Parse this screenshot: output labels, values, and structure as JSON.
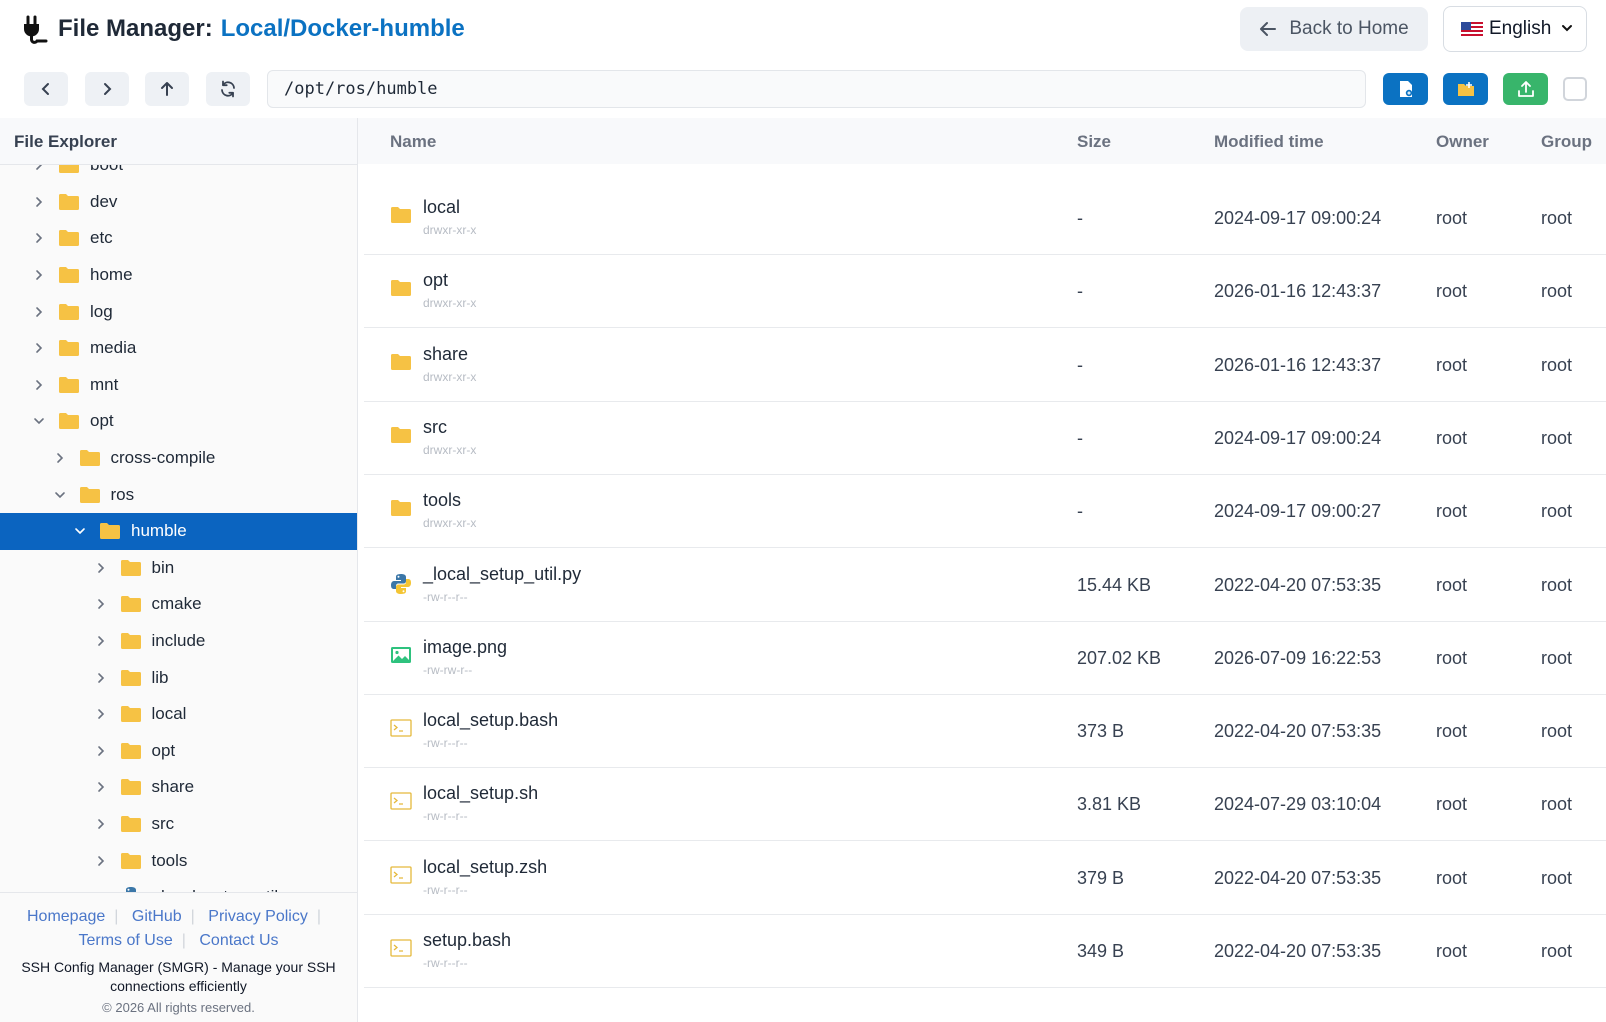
{
  "header": {
    "title": "File Manager:",
    "connection": "Local/Docker-humble",
    "back_label": "Back to Home",
    "language": "English",
    "plug_icon": "plug-icon",
    "flag_icon": "us-flag-icon"
  },
  "toolbar": {
    "path": "/opt/ros/humble",
    "buttons": [
      "back-icon",
      "forward-icon",
      "up-arrow-icon",
      "refresh-icon",
      "new-file-icon",
      "new-folder-icon",
      "upload-icon"
    ]
  },
  "sidebar": {
    "title": "File Explorer",
    "tree": [
      {
        "label": "boot",
        "depth": 0,
        "expanded": false,
        "selected": false
      },
      {
        "label": "dev",
        "depth": 0,
        "expanded": false,
        "selected": false
      },
      {
        "label": "etc",
        "depth": 0,
        "expanded": false,
        "selected": false
      },
      {
        "label": "home",
        "depth": 0,
        "expanded": false,
        "selected": false
      },
      {
        "label": "log",
        "depth": 0,
        "expanded": false,
        "selected": false
      },
      {
        "label": "media",
        "depth": 0,
        "expanded": false,
        "selected": false
      },
      {
        "label": "mnt",
        "depth": 0,
        "expanded": false,
        "selected": false
      },
      {
        "label": "opt",
        "depth": 0,
        "expanded": true,
        "selected": false
      },
      {
        "label": "cross-compile",
        "depth": 1,
        "expanded": false,
        "selected": false
      },
      {
        "label": "ros",
        "depth": 1,
        "expanded": true,
        "selected": false
      },
      {
        "label": "humble",
        "depth": 2,
        "expanded": true,
        "selected": true
      },
      {
        "label": "bin",
        "depth": 3,
        "expanded": false,
        "selected": false
      },
      {
        "label": "cmake",
        "depth": 3,
        "expanded": false,
        "selected": false
      },
      {
        "label": "include",
        "depth": 3,
        "expanded": false,
        "selected": false
      },
      {
        "label": "lib",
        "depth": 3,
        "expanded": false,
        "selected": false
      },
      {
        "label": "local",
        "depth": 3,
        "expanded": false,
        "selected": false
      },
      {
        "label": "opt",
        "depth": 3,
        "expanded": false,
        "selected": false
      },
      {
        "label": "share",
        "depth": 3,
        "expanded": false,
        "selected": false
      },
      {
        "label": "src",
        "depth": 3,
        "expanded": false,
        "selected": false
      },
      {
        "label": "tools",
        "depth": 3,
        "expanded": false,
        "selected": false
      },
      {
        "label": "_local_setup_util.py",
        "depth": 3,
        "file": true,
        "icon": "python-icon",
        "selected": false
      }
    ],
    "footer": {
      "links": [
        "Homepage",
        "GitHub",
        "Privacy Policy",
        "Terms of Use",
        "Contact Us"
      ],
      "description": "SSH Config Manager (SMGR) - Manage your SSH connections efficiently",
      "copyright": "© 2026 All rights reserved."
    }
  },
  "table": {
    "columns": [
      "Name",
      "Size",
      "Modified time",
      "Owner",
      "Group"
    ],
    "rows": [
      {
        "name": "local",
        "perm": "drwxr-xr-x",
        "size": "-",
        "modified": "2024-09-17 09:00:24",
        "owner": "root",
        "group": "root",
        "icon": "folder-icon"
      },
      {
        "name": "opt",
        "perm": "drwxr-xr-x",
        "size": "-",
        "modified": "2026-01-16 12:43:37",
        "owner": "root",
        "group": "root",
        "icon": "folder-icon"
      },
      {
        "name": "share",
        "perm": "drwxr-xr-x",
        "size": "-",
        "modified": "2026-01-16 12:43:37",
        "owner": "root",
        "group": "root",
        "icon": "folder-icon"
      },
      {
        "name": "src",
        "perm": "drwxr-xr-x",
        "size": "-",
        "modified": "2024-09-17 09:00:24",
        "owner": "root",
        "group": "root",
        "icon": "folder-icon"
      },
      {
        "name": "tools",
        "perm": "drwxr-xr-x",
        "size": "-",
        "modified": "2024-09-17 09:00:27",
        "owner": "root",
        "group": "root",
        "icon": "folder-icon"
      },
      {
        "name": "_local_setup_util.py",
        "perm": "-rw-r--r--",
        "size": "15.44 KB",
        "modified": "2022-04-20 07:53:35",
        "owner": "root",
        "group": "root",
        "icon": "python-icon"
      },
      {
        "name": "image.png",
        "perm": "-rw-rw-r--",
        "size": "207.02 KB",
        "modified": "2026-07-09 16:22:53",
        "owner": "root",
        "group": "root",
        "icon": "image-icon"
      },
      {
        "name": "local_setup.bash",
        "perm": "-rw-r--r--",
        "size": "373 B",
        "modified": "2022-04-20 07:53:35",
        "owner": "root",
        "group": "root",
        "icon": "terminal-file-icon"
      },
      {
        "name": "local_setup.sh",
        "perm": "-rw-r--r--",
        "size": "3.81 KB",
        "modified": "2024-07-29 03:10:04",
        "owner": "root",
        "group": "root",
        "icon": "terminal-file-icon"
      },
      {
        "name": "local_setup.zsh",
        "perm": "-rw-r--r--",
        "size": "379 B",
        "modified": "2022-04-20 07:53:35",
        "owner": "root",
        "group": "root",
        "icon": "terminal-file-icon"
      },
      {
        "name": "setup.bash",
        "perm": "-rw-r--r--",
        "size": "349 B",
        "modified": "2022-04-20 07:53:35",
        "owner": "root",
        "group": "root",
        "icon": "terminal-file-icon"
      }
    ]
  },
  "colors": {
    "accent": "#0b72c2",
    "selected": "#0b64c0",
    "folder": "#f6c244",
    "upload": "#38b56b",
    "image": "#2ec27e"
  }
}
